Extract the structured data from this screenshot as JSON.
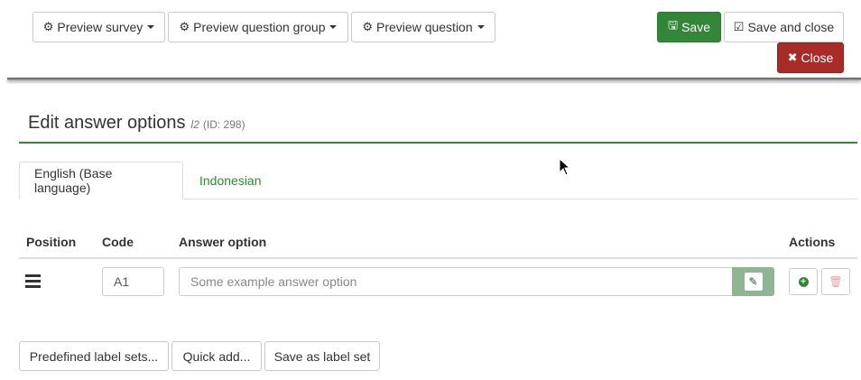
{
  "toolbar": {
    "preview_survey": "Preview survey",
    "preview_question_group": "Preview question group",
    "preview_question": "Preview question",
    "save": "Save",
    "save_and_close": "Save and close",
    "close": "Close"
  },
  "page": {
    "title": "Edit answer options",
    "question_code": "l2",
    "question_id": "(ID: 298)"
  },
  "tabs": [
    {
      "label": "English (Base language)",
      "active": true
    },
    {
      "label": "Indonesian",
      "active": false
    }
  ],
  "table": {
    "headers": {
      "position": "Position",
      "code": "Code",
      "answer_option": "Answer option",
      "actions": "Actions"
    },
    "rows": [
      {
        "code": "A1",
        "answer_option": "",
        "answer_placeholder": "Some example answer option"
      }
    ]
  },
  "footer": {
    "predefined": "Predefined label sets...",
    "quick_add": "Quick add...",
    "save_label_set": "Save as label set"
  },
  "colors": {
    "accent": "#328637",
    "danger": "#a82b28"
  }
}
